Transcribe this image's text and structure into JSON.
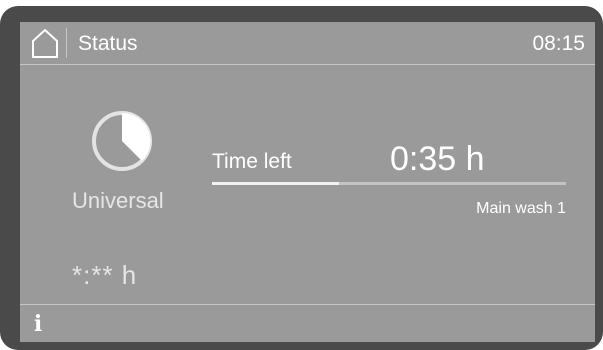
{
  "header": {
    "home_icon": "home-icon",
    "title": "Status",
    "clock": "08:15"
  },
  "program": {
    "icon": "program-pie-icon",
    "name": "Universal",
    "start_time": "*:** h"
  },
  "progress": {
    "time_left_label": "Time left",
    "time_value": "0:35 h",
    "phase": "Main wash 1",
    "fraction_complete": 0.36
  },
  "footer": {
    "info_icon": "info-icon",
    "info_glyph": "i"
  },
  "colors": {
    "bezel": "#4a4a4a",
    "screen": "#9a9a9a",
    "text": "#ffffff",
    "rule": "#c4c4c4",
    "progress_track": "#c3c3c3",
    "progress_fill": "#f2f2f2"
  }
}
